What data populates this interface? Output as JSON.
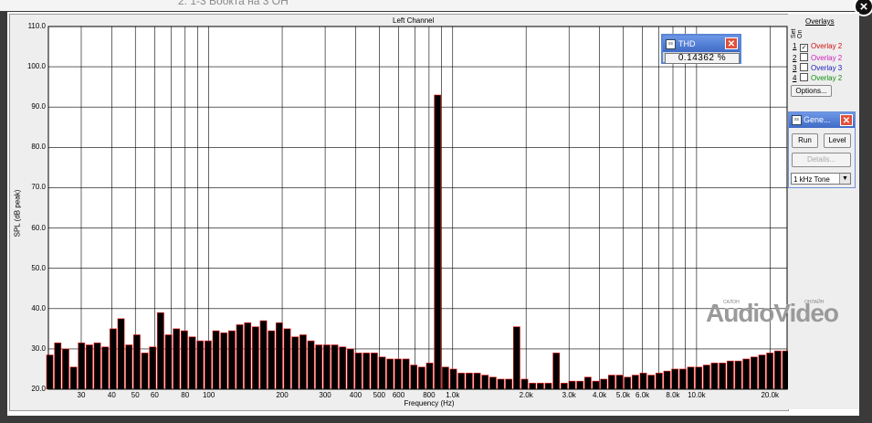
{
  "background_text": "2. 1-3 Воокта на 3 ОН",
  "chart_data": {
    "type": "bar",
    "title": "Left Channel",
    "xlabel": "Frequency (Hz)",
    "ylabel": "SPL (dB peak)",
    "x_scale": "log",
    "xlim": [
      22,
      23500
    ],
    "ylim": [
      20,
      110
    ],
    "grid": true,
    "ytick_labels": [
      "110.0",
      "100.0",
      "90.0",
      "80.0",
      "70.0",
      "60.0",
      "50.0",
      "40.0",
      "30.0",
      "20.0"
    ],
    "ytick_values": [
      110,
      100,
      90,
      80,
      70,
      60,
      50,
      40,
      30,
      20
    ],
    "xtick_labels": [
      "30",
      "40",
      "50",
      "60",
      "80",
      "100",
      "200",
      "300",
      "400",
      "500",
      "600",
      "800",
      "1.0k",
      "2.0k",
      "3.0k",
      "4.0k",
      "5.0k",
      "6.0k",
      "8.0k",
      "10.0k",
      "20.0k"
    ],
    "xtick_values": [
      30,
      40,
      50,
      60,
      80,
      100,
      200,
      300,
      400,
      500,
      600,
      800,
      1000,
      2000,
      3000,
      4000,
      5000,
      6000,
      8000,
      10000,
      20000
    ],
    "values": [
      28.5,
      31.5,
      30,
      25.5,
      31.5,
      31,
      31.5,
      30.5,
      35,
      37.5,
      31,
      33.5,
      29,
      30.5,
      39,
      33.5,
      35,
      34.5,
      33,
      32,
      32,
      34.5,
      34,
      34.5,
      36,
      36.5,
      35.5,
      37,
      34.5,
      36.5,
      35,
      33,
      33.5,
      32,
      31,
      31,
      31,
      30.5,
      30,
      29,
      29,
      29,
      28,
      27.5,
      27.5,
      27.5,
      26,
      25.5,
      26.5,
      93,
      25.5,
      25,
      24,
      24,
      24,
      23.5,
      23,
      22.5,
      22.5,
      35.5,
      22.5,
      21.5,
      21.5,
      21.5,
      29,
      21.5,
      22,
      22,
      23,
      22,
      22.5,
      23.5,
      23.5,
      23,
      23.5,
      24,
      23.5,
      24,
      24.5,
      25,
      25,
      25.5,
      25.5,
      26,
      26.5,
      26.5,
      27,
      27,
      27.5,
      28,
      28.5,
      29,
      29.5,
      29.5
    ]
  },
  "overlays": {
    "title": "Overlays",
    "set_label": "Set",
    "on_label": "On",
    "items": [
      {
        "num": "1",
        "checked": true,
        "label": "Overlay 2",
        "color": "#d01010"
      },
      {
        "num": "2",
        "checked": false,
        "label": "Overlay 2",
        "color": "#d020c0"
      },
      {
        "num": "3",
        "checked": false,
        "label": "Overlay 3",
        "color": "#2020c0"
      },
      {
        "num": "4",
        "checked": false,
        "label": "Overlay 2",
        "color": "#109010"
      }
    ],
    "options_label": "Options..."
  },
  "thd": {
    "title": "THD",
    "value": "0.14362 %"
  },
  "generator": {
    "title": "Gene...",
    "run_label": "Run",
    "level_label": "Level",
    "details_label": "Details...",
    "tone_selected": "1 kHz Tone"
  },
  "watermark": {
    "small_left": "САЛОН",
    "small_right": "ОНЛАЙН",
    "main": "AudioVideo"
  },
  "colors": {
    "bar_fill": "#000000",
    "bar_outline": "#ff2020",
    "grid": "#000000",
    "title_bar": "#4a78d0"
  }
}
